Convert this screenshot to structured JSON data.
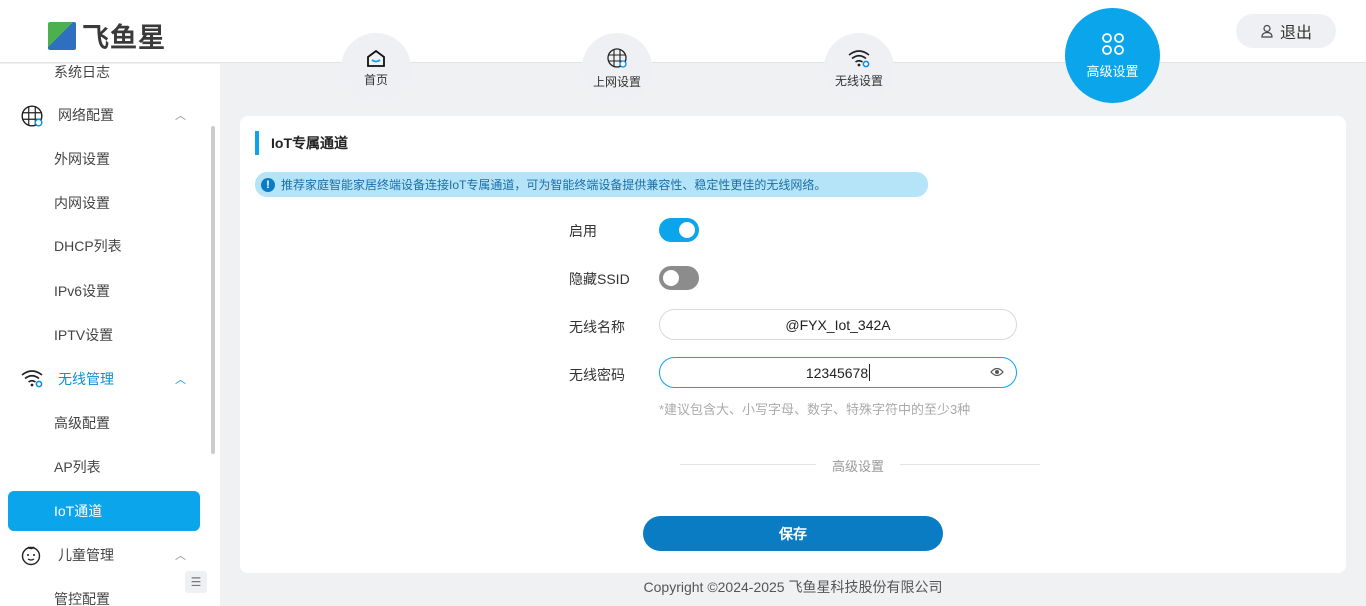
{
  "brand": {
    "name": "飞鱼星"
  },
  "header": {
    "logout": "退出"
  },
  "nav": [
    {
      "label": "首页"
    },
    {
      "label": "上网设置"
    },
    {
      "label": "无线设置"
    },
    {
      "label": "高级设置"
    }
  ],
  "sidebar": {
    "items": [
      {
        "label": "系统日志"
      },
      {
        "label": "网络配置"
      },
      {
        "label": "外网设置"
      },
      {
        "label": "内网设置"
      },
      {
        "label": "DHCP列表"
      },
      {
        "label": "IPv6设置"
      },
      {
        "label": "IPTV设置"
      },
      {
        "label": "无线管理"
      },
      {
        "label": "高级配置"
      },
      {
        "label": "AP列表"
      },
      {
        "label": "IoT通道"
      },
      {
        "label": "儿童管理"
      },
      {
        "label": "管控配置"
      }
    ]
  },
  "main": {
    "title": "IoT专属通道",
    "tip": "推荐家庭智能家居终端设备连接IoT专属通道，可为智能终端设备提供兼容性、稳定性更佳的无线网络。",
    "enable_label": "启用",
    "enable_on": true,
    "hide_ssid_label": "隐藏SSID",
    "hide_ssid_on": false,
    "ssid_label": "无线名称",
    "ssid_value": "@FYX_Iot_342A",
    "password_label": "无线密码",
    "password_value": "12345678",
    "password_hint": "*建议包含大、小写字母、数字、特殊字符中的至少3种",
    "advanced": "高级设置",
    "save": "保存"
  },
  "footer": "Copyright ©2024-2025 飞鱼星科技股份有限公司",
  "colors": {
    "accent": "#0aa5ea",
    "save": "#0a7cc4",
    "toggle_off": "#8c8c8c"
  }
}
